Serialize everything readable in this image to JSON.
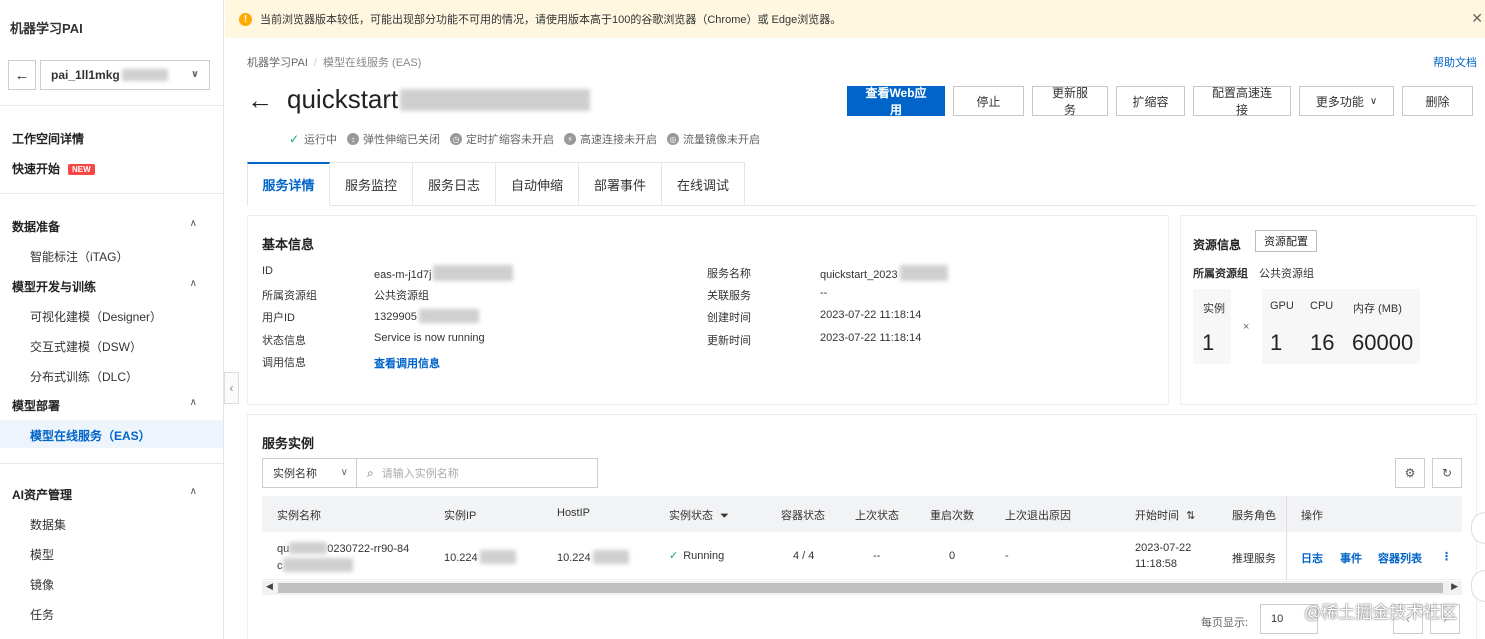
{
  "sidebar": {
    "title": "机器学习PAI",
    "workspace": "pai_1ll1mkg",
    "items": {
      "workspace_detail": "工作空间详情",
      "quick_start": "快速开始",
      "new_badge": "NEW",
      "data_prep": "数据准备",
      "itag": "智能标注（iTAG）",
      "model_dev": "模型开发与训练",
      "designer": "可视化建模（Designer）",
      "dsw": "交互式建模（DSW）",
      "dlc": "分布式训练（DLC）",
      "model_deploy": "模型部署",
      "eas": "模型在线服务（EAS）",
      "ai_assets": "AI资产管理",
      "dataset": "数据集",
      "model": "模型",
      "image": "镜像",
      "task": "任务"
    }
  },
  "warning": "当前浏览器版本较低，可能出现部分功能不可用的情况，请使用版本高于100的谷歌浏览器（Chrome）或 Edge浏览器。",
  "header": {
    "breadcrumb": [
      "机器学习PAI",
      "模型在线服务 (EAS)"
    ],
    "help": "帮助文档",
    "title": "quickstart",
    "actions": [
      "查看Web应用",
      "停止",
      "更新服务",
      "扩缩容",
      "配置高速连接",
      "更多功能",
      "删除"
    ],
    "status": [
      "运行中",
      "弹性伸缩已关闭",
      "定时扩缩容未开启",
      "高速连接未开启",
      "流量镜像未开启"
    ]
  },
  "tabs": [
    "服务详情",
    "服务监控",
    "服务日志",
    "自动伸缩",
    "部署事件",
    "在线调试"
  ],
  "basic": {
    "title": "基本信息",
    "left": [
      {
        "label": "ID",
        "value": "eas-m-j1d7j"
      },
      {
        "label": "所属资源组",
        "value": "公共资源组"
      },
      {
        "label": "用户ID",
        "value": "1329905"
      },
      {
        "label": "状态信息",
        "value": "Service is now running"
      },
      {
        "label": "调用信息",
        "value": "查看调用信息"
      }
    ],
    "right": [
      {
        "label": "服务名称",
        "value": "quickstart_2023"
      },
      {
        "label": "关联服务",
        "value": "--"
      },
      {
        "label": "创建时间",
        "value": "2023-07-22 11:18:14"
      },
      {
        "label": "更新时间",
        "value": "2023-07-22 11:18:14"
      }
    ]
  },
  "resource": {
    "title": "资源信息",
    "config_btn": "资源配置",
    "group_label": "所属资源组",
    "group_value": "公共资源组",
    "instance_label": "实例",
    "instance_value": "1",
    "times": "×",
    "gpu_label": "GPU",
    "gpu_value": "1",
    "cpu_label": "CPU",
    "cpu_value": "16",
    "mem_label": "内存 (MB)",
    "mem_value": "60000"
  },
  "instances": {
    "title": "服务实例",
    "filter": "实例名称",
    "search_placeholder": "请输入实例名称",
    "columns": [
      "实例名称",
      "实例IP",
      "HostIP",
      "实例状态",
      "容器状态",
      "上次状态",
      "重启次数",
      "上次退出原因",
      "开始时间",
      "服务角色",
      "操作"
    ],
    "row": {
      "name_a": "qu",
      "name_b": "0230722-rr90-84",
      "name_c": "c",
      "ip": "10.224",
      "host_ip": "10.224",
      "status": "Running",
      "container": "4 / 4",
      "last_status": "--",
      "restarts": "0",
      "exit_reason": "-",
      "start_date": "2023-07-22",
      "start_time": "11:18:58",
      "role": "推理服务",
      "ops": [
        "日志",
        "事件",
        "容器列表"
      ]
    }
  },
  "pager": {
    "label": "每页显示:",
    "size": "10"
  },
  "watermark": "@稀土掘金技术社区"
}
